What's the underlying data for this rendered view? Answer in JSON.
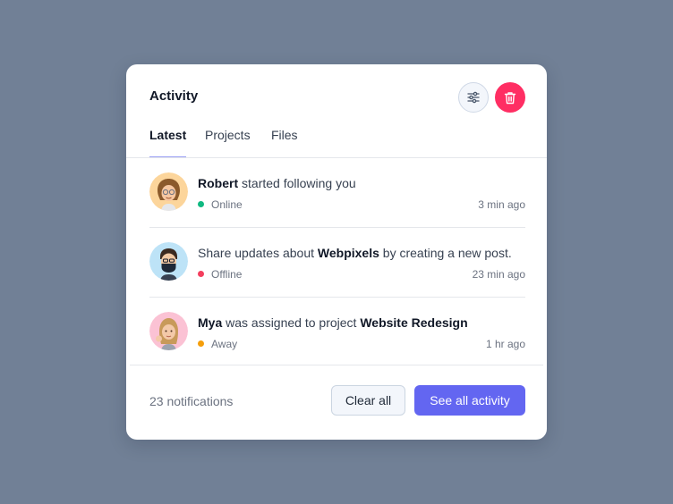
{
  "card": {
    "title": "Activity",
    "actions": {
      "filter_icon": "sliders-icon",
      "delete_icon": "trash-icon"
    }
  },
  "tabs": [
    {
      "label": "Latest",
      "active": true
    },
    {
      "label": "Projects",
      "active": false
    },
    {
      "label": "Files",
      "active": false
    }
  ],
  "activities": [
    {
      "avatar": "robert-avatar",
      "parts": [
        {
          "b": "Robert"
        },
        {
          "t": " started following you"
        }
      ],
      "status": "Online",
      "status_color": "#10b981",
      "time": "3 min ago"
    },
    {
      "avatar": "masked-man-avatar",
      "parts": [
        {
          "t": "Share updates about "
        },
        {
          "b": "Webpixels"
        },
        {
          "t": " by creating a new post."
        }
      ],
      "status": "Offline",
      "status_color": "#f43f5e",
      "time": "23 min ago"
    },
    {
      "avatar": "mya-avatar",
      "parts": [
        {
          "b": "Mya"
        },
        {
          "t": " was assigned to project "
        },
        {
          "b": "Website Redesign"
        }
      ],
      "status": "Away",
      "status_color": "#f59e0b",
      "time": "1 hr ago"
    }
  ],
  "footer": {
    "count_text": "23 notifications",
    "clear_label": "Clear all",
    "see_all_label": "See all activity"
  },
  "colors": {
    "backdrop": "#718096",
    "accent": "#6366f1",
    "danger": "#ff2e63"
  }
}
